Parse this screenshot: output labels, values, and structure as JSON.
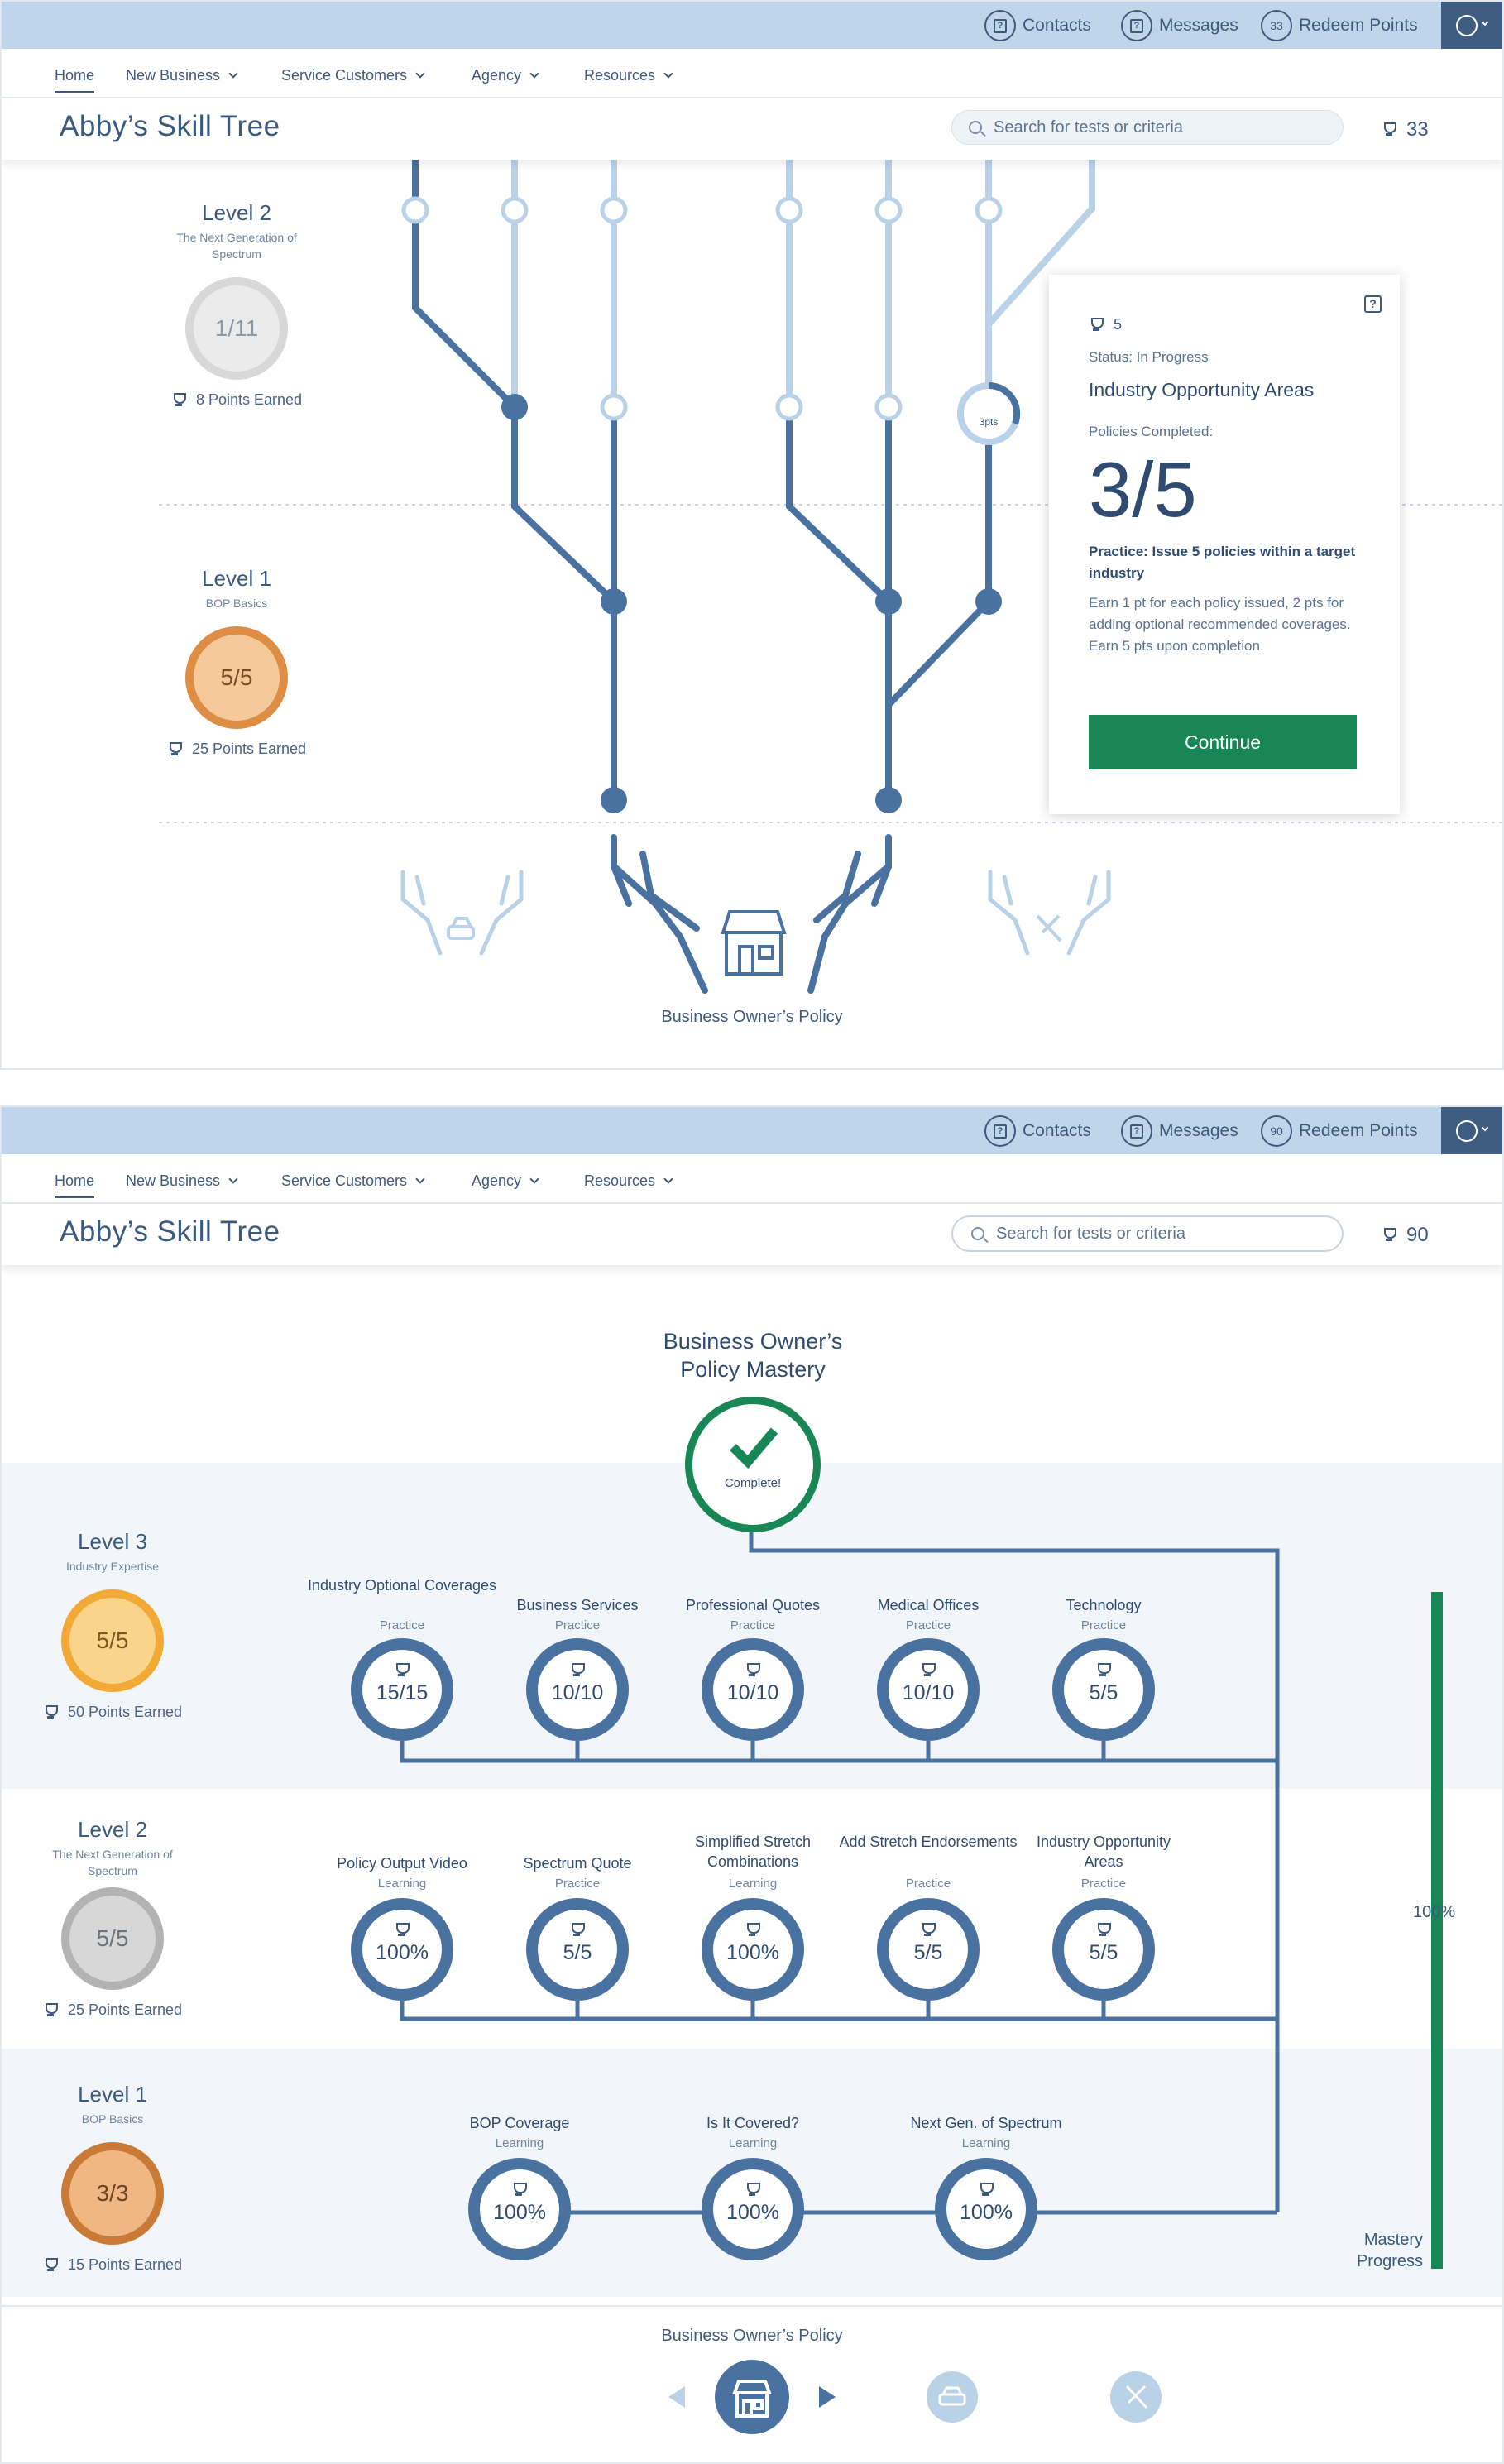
{
  "screens": [
    {
      "topbar": {
        "contacts": "Contacts",
        "messages": "Messages",
        "points_badge": "33",
        "redeem": "Redeem Points"
      },
      "nav": [
        "Home",
        "New Business",
        "Service Customers",
        "Agency",
        "Resources"
      ],
      "title": "Abby’s Skill Tree",
      "search_placeholder": "Search for tests or criteria",
      "points": "33",
      "levels": [
        {
          "title": "Level 2",
          "subtitle": "The Next Generation  of Spectrum",
          "medal": "1/11",
          "earned": "8 Points Earned"
        },
        {
          "title": "Level 1",
          "subtitle": "BOP Basics",
          "medal": "5/5",
          "earned": "25 Points Earned"
        }
      ],
      "node_badge": "3pts",
      "popup": {
        "points": "5",
        "status": "Status: In Progress",
        "title": "Industry Opportunity Areas",
        "label": "Policies Completed:",
        "fraction": "3/5",
        "practice": "Practice: Issue 5 policies within a target industry",
        "desc": "Earn 1 pt for each policy issued, 2 pts for adding optional recommended coverages. Earn 5 pts upon completion.",
        "button": "Continue"
      },
      "tree_label": "Business Owner’s Policy"
    },
    {
      "topbar": {
        "contacts": "Contacts",
        "messages": "Messages",
        "points_badge": "90",
        "redeem": "Redeem Points"
      },
      "nav": [
        "Home",
        "New Business",
        "Service Customers",
        "Agency",
        "Resources"
      ],
      "title": "Abby’s Skill Tree",
      "search_placeholder": "Search for tests or criteria",
      "points": "90",
      "mastery_title": [
        "Business Owner’s",
        "Policy Mastery"
      ],
      "complete": "Complete!",
      "levels": [
        {
          "title": "Level 3",
          "subtitle": "Industry Expertise",
          "medal": "5/5",
          "earned": "50 Points Earned",
          "nodes": [
            {
              "title": "Industry Optional Coverages",
              "type": "Practice",
              "value": "15/15"
            },
            {
              "title": "Business Services",
              "type": "Practice",
              "value": "10/10"
            },
            {
              "title": "Professional Quotes",
              "type": "Practice",
              "value": "10/10"
            },
            {
              "title": "Medical Offices",
              "type": "Practice",
              "value": "10/10"
            },
            {
              "title": "Technology",
              "type": "Practice",
              "value": "5/5"
            }
          ]
        },
        {
          "title": "Level 2",
          "subtitle": "The Next Generation of Spectrum",
          "medal": "5/5",
          "earned": "25 Points Earned",
          "nodes": [
            {
              "title": "Policy Output Video",
              "type": "Learning",
              "value": "100%"
            },
            {
              "title": "Spectrum Quote",
              "type": "Practice",
              "value": "5/5"
            },
            {
              "title": "Simplified Stretch Combinations",
              "type": "Learning",
              "value": "100%"
            },
            {
              "title": "Add Stretch Endorsements",
              "type": "Practice",
              "value": "5/5"
            },
            {
              "title": "Industry Opportunity Areas",
              "type": "Practice",
              "value": "5/5"
            }
          ]
        },
        {
          "title": "Level 1",
          "subtitle": "BOP Basics",
          "medal": "3/3",
          "earned": "15 Points Earned",
          "nodes": [
            {
              "title": "BOP Coverage",
              "type": "Learning",
              "value": "100%"
            },
            {
              "title": "Is It Covered?",
              "type": "Learning",
              "value": "100%"
            },
            {
              "title": "Next Gen. of Spectrum",
              "type": "Learning",
              "value": "100%"
            }
          ]
        }
      ],
      "progress": {
        "label": "100%",
        "caption": "Mastery Progress",
        "fraction": 1.0
      },
      "carousel_label": "Business Owner’s Policy"
    }
  ],
  "colors": {
    "primary": "#4a72a0",
    "light": "#b9d2e8",
    "accent": "#188755",
    "topbar": "#bfd5e9",
    "dark": "#3e5d80"
  },
  "icons": [
    "contacts-icon",
    "messages-icon",
    "user-icon",
    "search-icon",
    "trophy-icon",
    "storefront-icon",
    "car-icon",
    "tools-icon",
    "checkmark-icon",
    "help-icon"
  ]
}
